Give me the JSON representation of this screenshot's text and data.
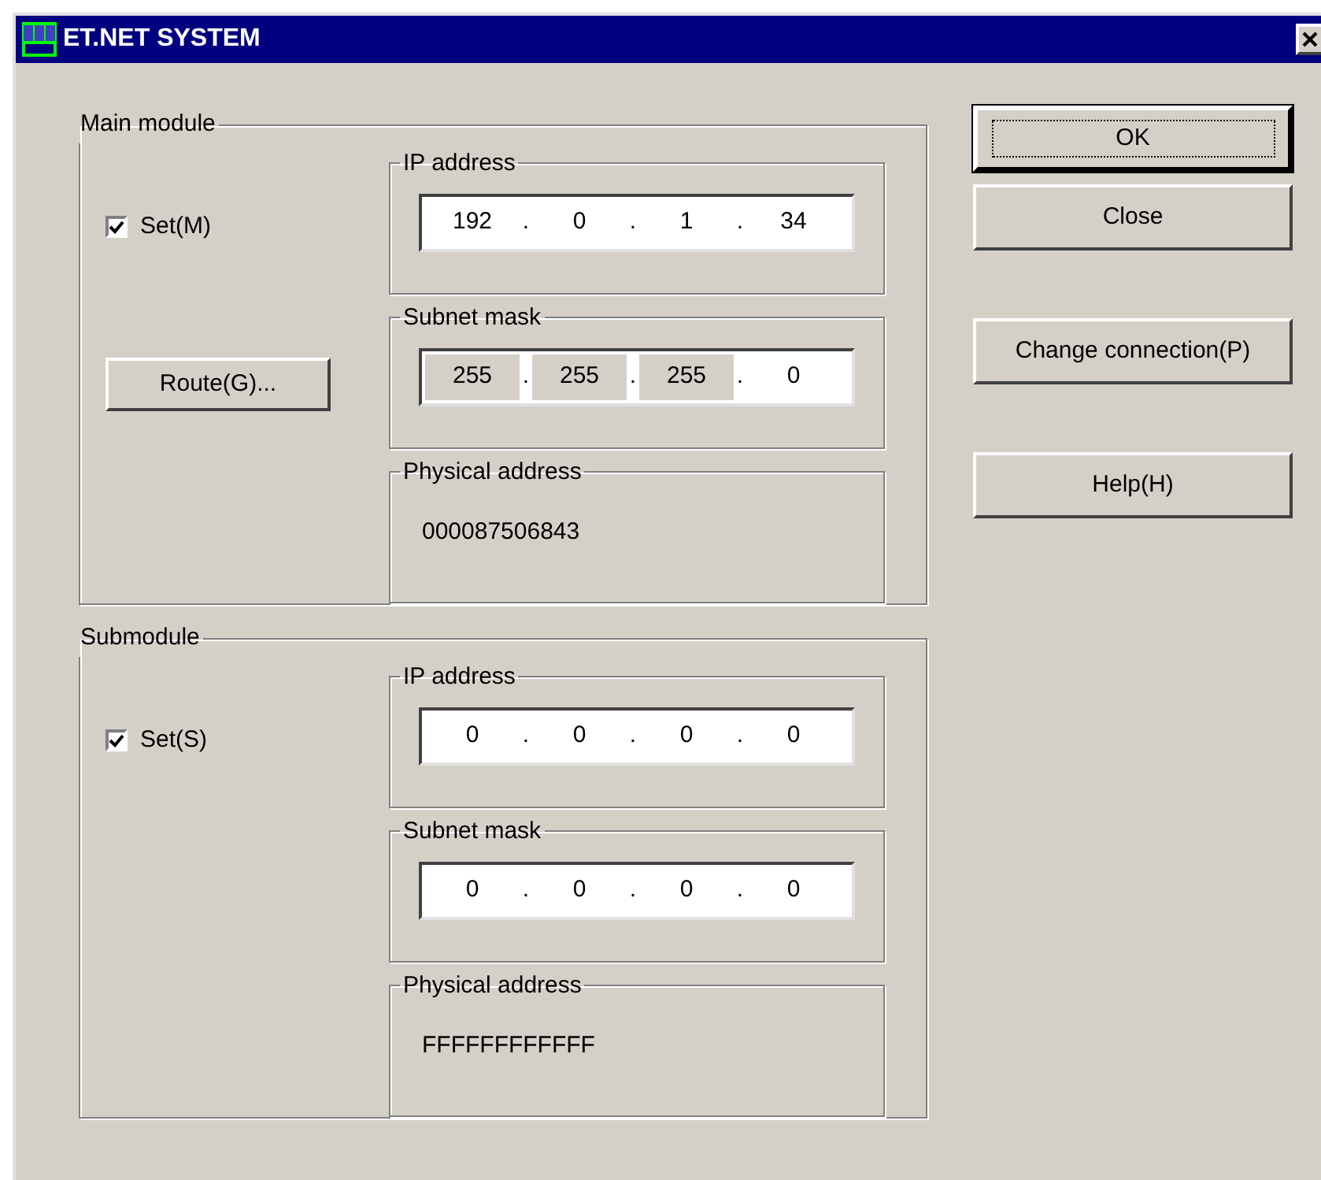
{
  "window": {
    "title": "ET.NET SYSTEM"
  },
  "modules": [
    {
      "title": "Main module",
      "set": {
        "label": "Set(M)",
        "checked": true
      },
      "route_button": {
        "label": "Route(G)..."
      },
      "ip": {
        "label": "IP address",
        "octets": [
          {
            "value": "192",
            "selected": false
          },
          {
            "value": "0",
            "selected": false
          },
          {
            "value": "1",
            "selected": false
          },
          {
            "value": "34",
            "selected": false
          }
        ]
      },
      "subnet": {
        "label": "Subnet mask",
        "octets": [
          {
            "value": "255",
            "selected": true
          },
          {
            "value": "255",
            "selected": true
          },
          {
            "value": "255",
            "selected": true
          },
          {
            "value": "0",
            "selected": false
          }
        ]
      },
      "physical": {
        "label": "Physical address",
        "value": "000087506843"
      }
    },
    {
      "title": "Submodule",
      "set": {
        "label": "Set(S)",
        "checked": true
      },
      "ip": {
        "label": "IP address",
        "octets": [
          {
            "value": "0",
            "selected": false
          },
          {
            "value": "0",
            "selected": false
          },
          {
            "value": "0",
            "selected": false
          },
          {
            "value": "0",
            "selected": false
          }
        ]
      },
      "subnet": {
        "label": "Subnet mask",
        "octets": [
          {
            "value": "0",
            "selected": false
          },
          {
            "value": "0",
            "selected": false
          },
          {
            "value": "0",
            "selected": false
          },
          {
            "value": "0",
            "selected": false
          }
        ]
      },
      "physical": {
        "label": "Physical address",
        "value": "FFFFFFFFFFFF"
      }
    }
  ],
  "buttons": [
    {
      "label": "OK",
      "default": true
    },
    {
      "label": "Close",
      "default": false
    },
    {
      "label": "Change connection(P)",
      "default": false
    },
    {
      "label": "Help(H)",
      "default": false
    }
  ],
  "octet_separator": "."
}
